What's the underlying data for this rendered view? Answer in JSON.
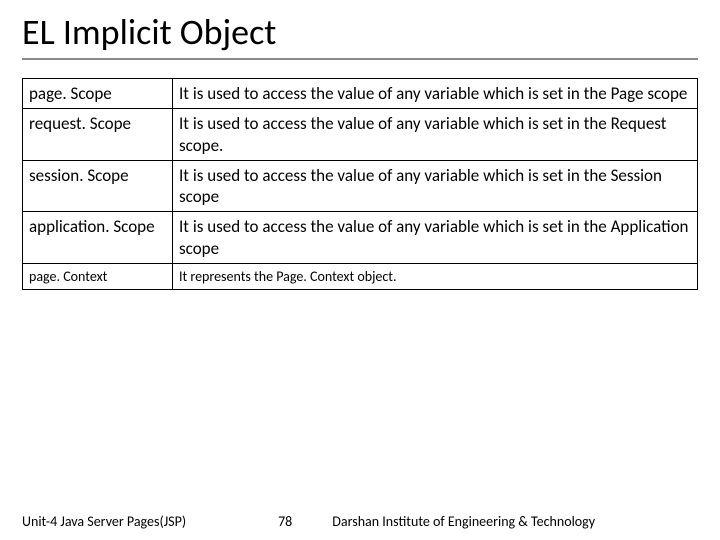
{
  "title": "EL Implicit Object",
  "rows": [
    {
      "name": "page. Scope",
      "desc": "It is used to access the value of any variable which is set in the Page scope"
    },
    {
      "name": "request. Scope",
      "desc": "It is used to access the value of any variable which is set in the Request scope."
    },
    {
      "name": "session. Scope",
      "desc": "It is used to access the value of any variable which is set in the Session scope"
    },
    {
      "name": "application. Scope",
      "desc": "It is used to access the value of any variable which is set in the Application scope"
    },
    {
      "name": "page. Context",
      "desc": "It represents the Page. Context object.",
      "small": true
    }
  ],
  "footer": {
    "left": "Unit-4 Java Server Pages(JSP)",
    "page": "78",
    "right": "Darshan Institute of Engineering & Technology"
  }
}
